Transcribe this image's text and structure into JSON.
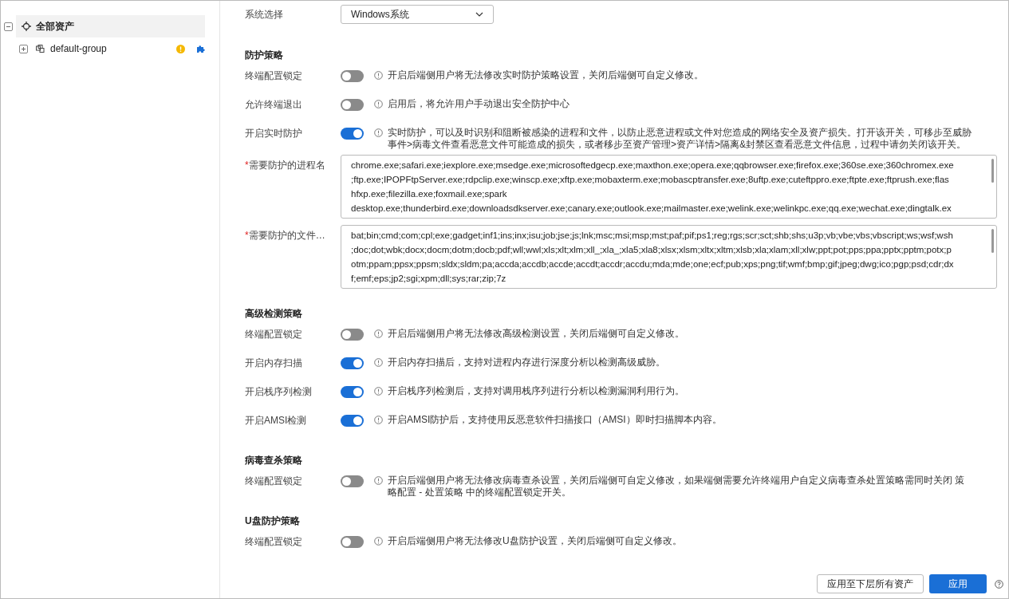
{
  "tree": {
    "root": {
      "label": "全部资产",
      "expanded": true,
      "selected": true
    },
    "children": [
      {
        "label": "default-group",
        "expanded": false
      }
    ]
  },
  "sections": [
    {
      "rows": [
        {
          "kind": "select",
          "label": "系统选择",
          "value": "Windows系统"
        }
      ]
    },
    {
      "title": "防护策略",
      "rows": [
        {
          "kind": "toggle",
          "label": "终端配置锁定",
          "on": false,
          "hint": "开启后端侧用户将无法修改实时防护策略设置，关闭后端侧可自定义修改。"
        },
        {
          "kind": "toggle",
          "label": "允许终端退出",
          "on": false,
          "hint": "启用后，将允许用户手动退出安全防护中心"
        },
        {
          "kind": "toggle",
          "label": "开启实时防护",
          "on": true,
          "hint": "实时防护，可以及时识别和阻断被感染的进程和文件，以防止恶意进程或文件对您造成的网络安全及资产损失。打开该开关，可移步至威胁事件>病毒文件查看恶意文件可能造成的损失，或者移步至资产管理>资产详情>隔离&封禁区查看恶意文件信息，过程中请勿关闭该开关。"
        },
        {
          "kind": "textarea",
          "label": "需要防护的进程名",
          "marker": "*",
          "value": "chrome.exe;safari.exe;iexplore.exe;msedge.exe;microsoftedgecp.exe;maxthon.exe;opera.exe;qqbrowser.exe;firefox.exe;360se.exe;360chromex.exe\n;ftp.exe;IPOPFtpServer.exe;rdpclip.exe;winscp.exe;xftp.exe;mobaxterm.exe;mobascptransfer.exe;8uftp.exe;cuteftppro.exe;ftpte.exe;ftprush.exe;flas\nhfxp.exe;filezilla.exe;foxmail.exe;spark\ndesktop.exe;thunderbird.exe;downloadsdkserver.exe;canary.exe;outlook.exe;mailmaster.exe;welink.exe;welinkpc.exe;qq.exe;wechat.exe;dingtalk.ex"
        },
        {
          "kind": "textarea",
          "label": "需要防护的文件…",
          "marker": "*",
          "value": "bat;bin;cmd;com;cpl;exe;gadget;inf1;ins;inx;isu;job;jse;js;lnk;msc;msi;msp;mst;paf;pif;ps1;reg;rgs;scr;sct;shb;shs;u3p;vb;vbe;vbs;vbscript;ws;wsf;wsh\n;doc;dot;wbk;docx;docm;dotm;docb;pdf;wll;wwl;xls;xlt;xlm;xll_;xla_;xla5;xla8;xlsx;xlsm;xltx;xltm;xlsb;xla;xlam;xll;xlw;ppt;pot;pps;ppa;pptx;pptm;potx;p\notm;ppam;ppsx;ppsm;sldx;sldm;pa;accda;accdb;accde;accdt;accdr;accdu;mda;mde;one;ecf;pub;xps;png;tif;wmf;bmp;gif;jpeg;dwg;ico;pgp;psd;cdr;dx\nf;emf;eps;jp2;sgi;xpm;dll;sys;rar;zip;7z"
        }
      ]
    },
    {
      "title": "高级检测策略",
      "rows": [
        {
          "kind": "toggle",
          "label": "终端配置锁定",
          "on": false,
          "hint": "开启后端侧用户将无法修改高级检测设置，关闭后端侧可自定义修改。"
        },
        {
          "kind": "toggle",
          "label": "开启内存扫描",
          "on": true,
          "hint": "开启内存扫描后，支持对进程内存进行深度分析以检测高级威胁。"
        },
        {
          "kind": "toggle",
          "label": "开启栈序列检测",
          "on": true,
          "hint": "开启栈序列检测后，支持对调用栈序列进行分析以检测漏洞利用行为。"
        },
        {
          "kind": "toggle",
          "label": "开启AMSI检测",
          "on": true,
          "hint": "开启AMSI防护后，支持使用反恶意软件扫描接口（AMSI）即时扫描脚本内容。"
        }
      ]
    },
    {
      "title": "病毒查杀策略",
      "rows": [
        {
          "kind": "toggle",
          "label": "终端配置锁定",
          "on": false,
          "hint": "开启后端侧用户将无法修改病毒查杀设置，关闭后端侧可自定义修改，如果端侧需要允许终端用户自定义病毒查杀处置策略需同时关闭 策略配置 - 处置策略 中的终端配置锁定开关。"
        }
      ]
    },
    {
      "title": "U盘防护策略",
      "rows": [
        {
          "kind": "toggle",
          "label": "终端配置锁定",
          "on": false,
          "hint": "开启后端侧用户将无法修改U盘防护设置，关闭后端侧可自定义修改。"
        }
      ]
    }
  ],
  "footer": {
    "buttons": [
      {
        "label": "应用至下层所有资产",
        "primary": false
      },
      {
        "label": "应用",
        "primary": true
      }
    ]
  }
}
